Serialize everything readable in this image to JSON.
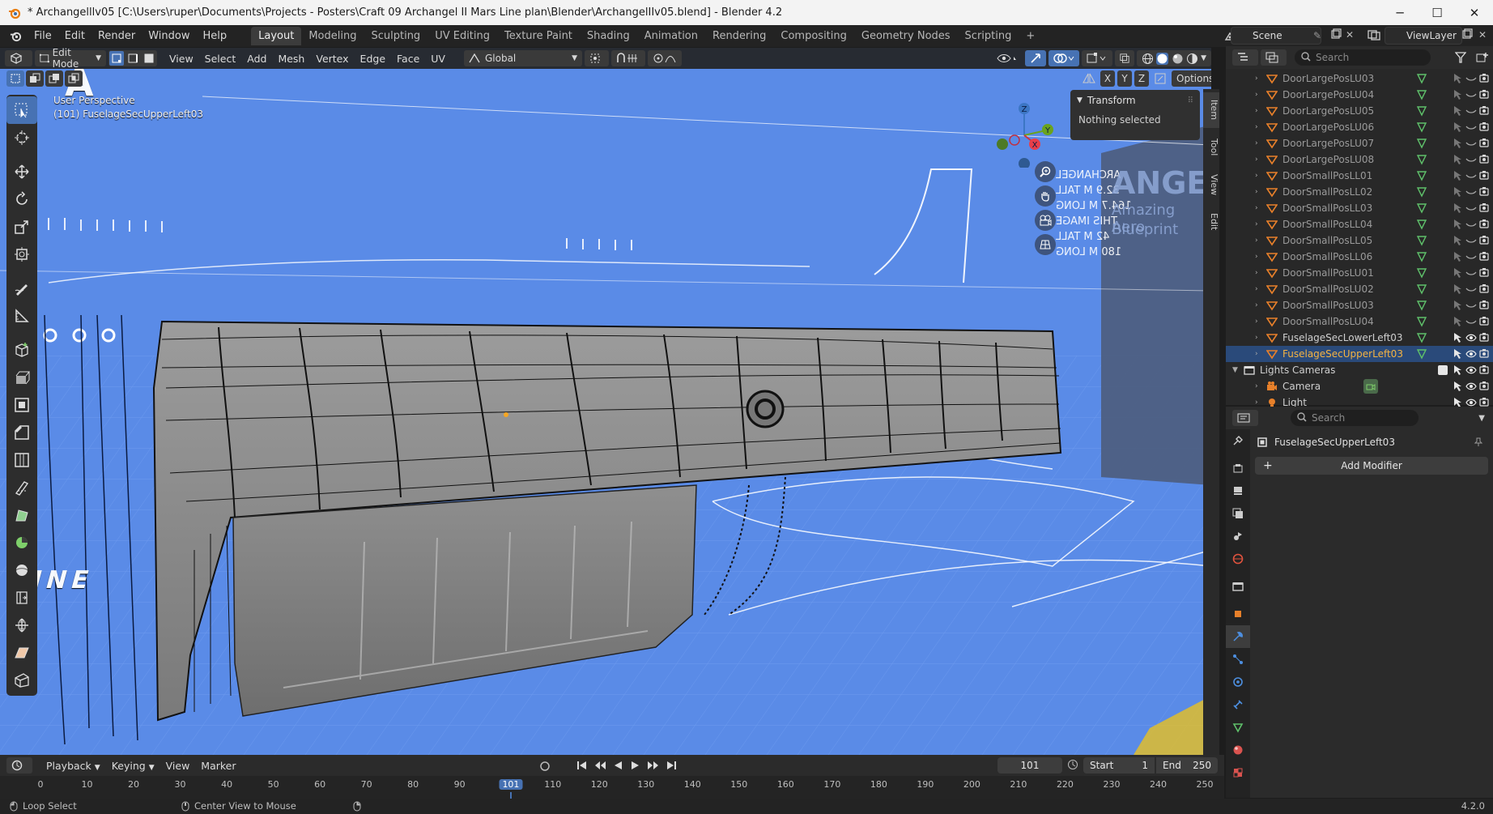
{
  "window": {
    "title": "* Archangelllv05 [C:\\Users\\ruper\\Documents\\Projects - Posters\\Craft 09 Archangel II Mars Line plan\\Blender\\ArchangelIIv05.blend] - Blender 4.2",
    "minimize": "─",
    "maximize": "☐",
    "close": "✕"
  },
  "menubar": {
    "items": [
      "File",
      "Edit",
      "Render",
      "Window",
      "Help"
    ],
    "workspaces": [
      "Layout",
      "Modeling",
      "Sculpting",
      "UV Editing",
      "Texture Paint",
      "Shading",
      "Animation",
      "Rendering",
      "Compositing",
      "Geometry Nodes",
      "Scripting"
    ],
    "active_workspace": "Layout",
    "add_workspace": "+",
    "scene": "Scene",
    "view_layer": "ViewLayer"
  },
  "viewport_header": {
    "mode": "Edit Mode",
    "menus": [
      "View",
      "Select",
      "Add",
      "Mesh",
      "Vertex",
      "Edge",
      "Face",
      "UV"
    ],
    "orientation": "Global",
    "options": "Options",
    "axes": [
      "X",
      "Y",
      "Z"
    ]
  },
  "viewport": {
    "perspective": "User Perspective",
    "object": "(101) FuselageSecUpperLeft03",
    "gizmo_labels": [
      "Z",
      "X",
      "Y"
    ],
    "blueprint_text": [
      "ARCHANGEL",
      "32.9 M TALL",
      "164.7 M LONG",
      "THIS IMAGE",
      "42 M TALL",
      "180 M LONG",
      "ANGEL",
      "Amazing Aero",
      "Blueprint",
      "A",
      "INE"
    ]
  },
  "npanel": {
    "section": "Transform",
    "message": "Nothing selected",
    "tabs": [
      "Item",
      "Tool",
      "View",
      "Edit"
    ]
  },
  "outliner": {
    "search_placeholder": "Search",
    "rows": [
      {
        "name": "DoorLargePosLU03",
        "dim": true
      },
      {
        "name": "DoorLargePosLU04",
        "dim": true
      },
      {
        "name": "DoorLargePosLU05",
        "dim": true
      },
      {
        "name": "DoorLargePosLU06",
        "dim": true
      },
      {
        "name": "DoorLargePosLU07",
        "dim": true
      },
      {
        "name": "DoorLargePosLU08",
        "dim": true
      },
      {
        "name": "DoorSmallPosLL01",
        "dim": true
      },
      {
        "name": "DoorSmallPosLL02",
        "dim": true
      },
      {
        "name": "DoorSmallPosLL03",
        "dim": true
      },
      {
        "name": "DoorSmallPosLL04",
        "dim": true
      },
      {
        "name": "DoorSmallPosLL05",
        "dim": true
      },
      {
        "name": "DoorSmallPosLL06",
        "dim": true
      },
      {
        "name": "DoorSmallPosLU01",
        "dim": true
      },
      {
        "name": "DoorSmallPosLU02",
        "dim": true
      },
      {
        "name": "DoorSmallPosLU03",
        "dim": true
      },
      {
        "name": "DoorSmallPosLU04",
        "dim": true
      },
      {
        "name": "FuselageSecLowerLeft03",
        "dim": false
      },
      {
        "name": "FuselageSecUpperLeft03",
        "dim": false,
        "selected": true
      },
      {
        "name": "Lights Cameras",
        "collection": true
      },
      {
        "name": "Camera",
        "camera": true
      },
      {
        "name": "Light",
        "light": true
      }
    ]
  },
  "properties": {
    "search_placeholder": "Search",
    "object_name": "FuselageSecUpperLeft03",
    "add_modifier": "Add Modifier"
  },
  "timeline": {
    "menus": [
      "Playback",
      "Keying",
      "View",
      "Marker"
    ],
    "current_frame": "101",
    "start_label": "Start",
    "start": "1",
    "end_label": "End",
    "end": "250",
    "ticks": [
      "0",
      "10",
      "20",
      "30",
      "40",
      "50",
      "60",
      "70",
      "80",
      "90",
      "101",
      "110",
      "120",
      "130",
      "140",
      "150",
      "160",
      "170",
      "180",
      "190",
      "200",
      "210",
      "220",
      "230",
      "240",
      "250"
    ]
  },
  "statusbar": {
    "left": "Loop Select",
    "middle": "Center View to Mouse",
    "version": "4.2.0"
  }
}
